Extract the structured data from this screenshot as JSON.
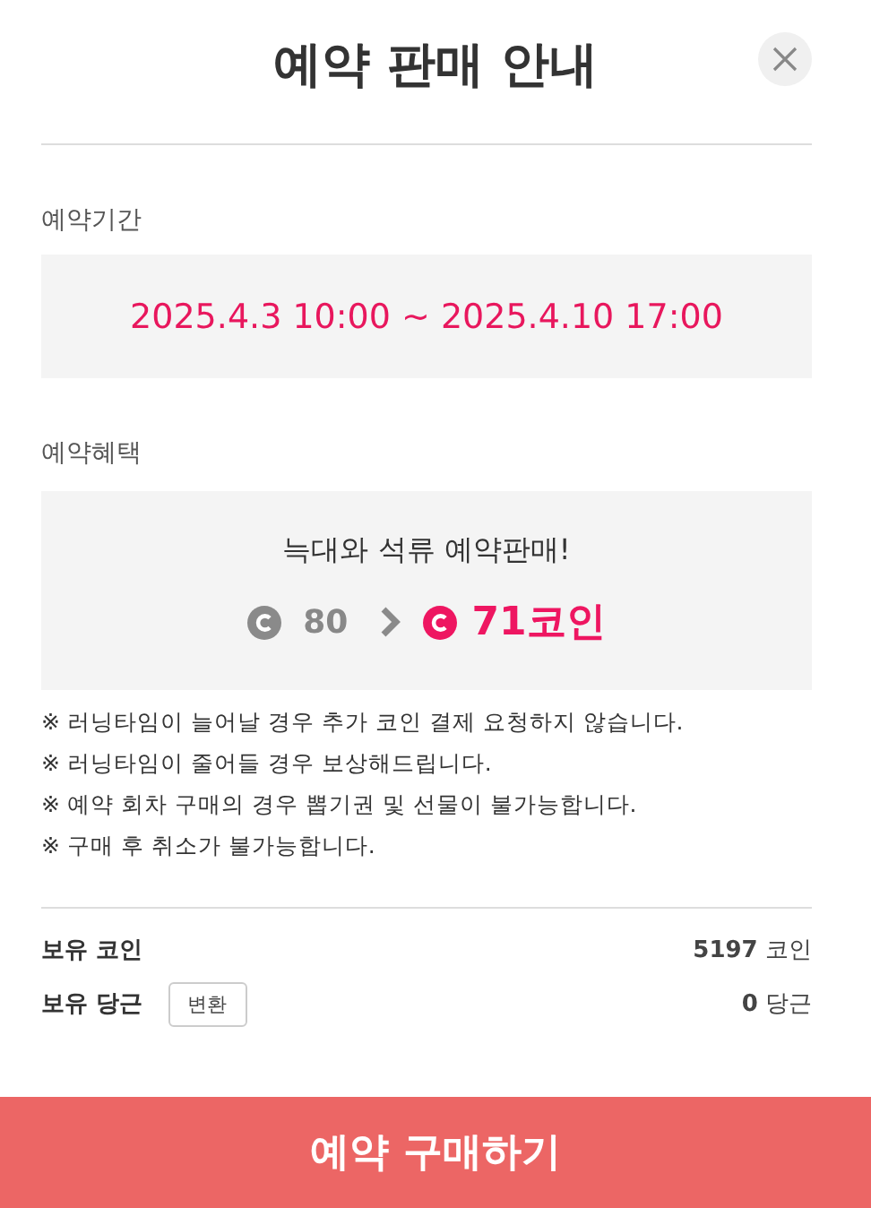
{
  "dialog": {
    "title": "예약 판매 안내"
  },
  "period": {
    "label": "예약기간",
    "value": "2025.4.3 10:00 ~ 2025.4.10 17:00"
  },
  "benefit": {
    "label": "예약혜택",
    "headline": "늑대와 석류 예약판매!",
    "original_price": "80",
    "sale_price": "71코인"
  },
  "notes": [
    "※ 러닝타임이 늘어날 경우 추가 코인 결제 요청하지 않습니다.",
    "※ 러닝타임이 줄어들 경우 보상해드립니다.",
    "※ 예약 회차 구매의 경우 뽑기권 및 선물이 불가능합니다.",
    "※ 구매 후 취소가 불가능합니다."
  ],
  "balances": [
    {
      "label": "보유 코인",
      "value": "**5197** 코인"
    },
    {
      "label": "보유 당근",
      "button": "변환",
      "value": "**0** 당근"
    }
  ],
  "purchase_button": "예약 구매하기"
}
